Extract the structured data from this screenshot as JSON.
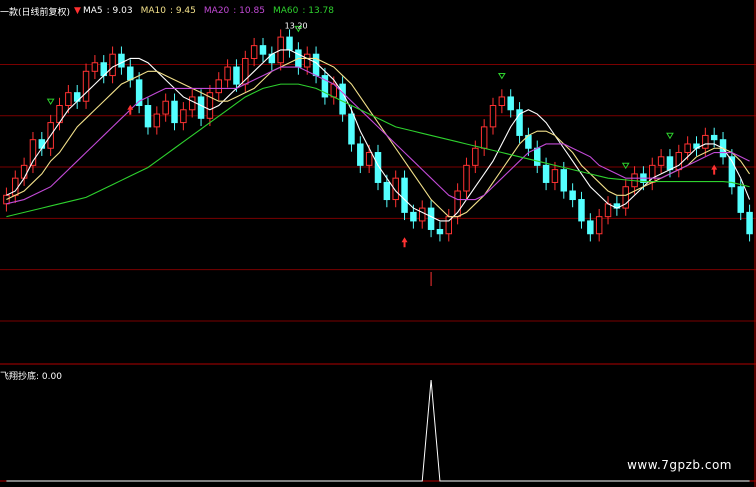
{
  "indicator": {
    "name": "一款(日线前复权)",
    "ma": [
      {
        "label": "MA5",
        "value": "9.03",
        "color": "#ffffff"
      },
      {
        "label": "MA10",
        "value": "9.45",
        "color": "#f2e08a"
      },
      {
        "label": "MA20",
        "value": "10.85",
        "color": "#c24ad6"
      },
      {
        "label": "MA60",
        "value": "13.78",
        "color": "#2ed12e"
      }
    ]
  },
  "sub_indicator": {
    "name": "飞翔抄底",
    "value": "0.00"
  },
  "watermark": "www.7gpzb.com",
  "colors": {
    "up": "#ff3232",
    "down": "#54ffff",
    "grid": "#7a0000",
    "spike": "#ffffff"
  },
  "chart_data": [
    {
      "type": "candlestick",
      "annotation": "13.20",
      "series": [
        {
          "name": "MA5",
          "values": [
            9.9,
            10.0,
            10.3,
            10.7,
            11.0,
            11.3,
            11.6,
            11.9,
            12.1,
            12.3,
            12.5,
            12.7,
            12.9,
            13.0,
            13.1,
            13.1,
            13.0,
            12.8,
            12.6,
            12.4,
            12.2,
            12.1,
            12.0,
            11.9,
            12.0,
            12.2,
            12.4,
            12.6,
            12.8,
            13.0,
            13.2,
            13.3,
            13.3,
            13.2,
            13.1,
            13.0,
            12.8,
            12.6,
            12.3,
            11.9,
            11.4,
            11.0,
            10.6,
            10.3,
            10.0,
            9.8,
            9.6,
            9.5,
            9.4,
            9.3,
            9.3,
            9.5,
            9.8,
            10.1,
            10.4,
            10.7,
            11.1,
            11.5,
            11.8,
            11.9,
            11.8,
            11.6,
            11.3,
            11.0,
            10.7,
            10.4,
            10.1,
            9.9,
            9.7,
            9.6,
            9.7,
            9.9,
            10.1,
            10.3,
            10.4,
            10.5,
            10.6,
            10.8,
            11.0,
            11.1,
            11.1,
            11.0,
            10.7,
            10.3,
            9.8
          ]
        },
        {
          "name": "MA10",
          "values": [
            9.8,
            9.9,
            10.0,
            10.2,
            10.4,
            10.7,
            10.9,
            11.2,
            11.5,
            11.7,
            11.9,
            12.1,
            12.3,
            12.5,
            12.6,
            12.7,
            12.8,
            12.8,
            12.7,
            12.6,
            12.5,
            12.4,
            12.3,
            12.2,
            12.1,
            12.1,
            12.2,
            12.3,
            12.4,
            12.6,
            12.8,
            12.9,
            13.0,
            13.1,
            13.1,
            13.1,
            13.0,
            12.9,
            12.7,
            12.5,
            12.2,
            11.9,
            11.6,
            11.3,
            11.0,
            10.7,
            10.4,
            10.1,
            9.8,
            9.6,
            9.4,
            9.4,
            9.5,
            9.7,
            9.9,
            10.2,
            10.5,
            10.8,
            11.1,
            11.3,
            11.4,
            11.4,
            11.3,
            11.1,
            10.9,
            10.6,
            10.4,
            10.2,
            10.0,
            9.9,
            9.9,
            10.0,
            10.1,
            10.2,
            10.3,
            10.4,
            10.5,
            10.6,
            10.8,
            10.9,
            11.0,
            11.0,
            10.9,
            10.7,
            10.4
          ]
        },
        {
          "name": "MA20",
          "values": [
            9.7,
            9.75,
            9.8,
            9.9,
            10.0,
            10.1,
            10.3,
            10.5,
            10.7,
            10.9,
            11.1,
            11.3,
            11.5,
            11.7,
            11.9,
            12.1,
            12.2,
            12.3,
            12.4,
            12.4,
            12.4,
            12.4,
            12.4,
            12.4,
            12.4,
            12.4,
            12.4,
            12.5,
            12.6,
            12.7,
            12.8,
            12.9,
            12.9,
            12.9,
            12.8,
            12.7,
            12.6,
            12.5,
            12.3,
            12.1,
            11.9,
            11.7,
            11.5,
            11.3,
            11.1,
            10.9,
            10.7,
            10.5,
            10.3,
            10.1,
            9.9,
            9.8,
            9.8,
            9.8,
            9.9,
            10.1,
            10.3,
            10.5,
            10.7,
            10.9,
            11.0,
            11.1,
            11.1,
            11.1,
            11.0,
            10.9,
            10.8,
            10.6,
            10.5,
            10.4,
            10.3,
            10.3,
            10.3,
            10.3,
            10.3,
            10.4,
            10.5,
            10.6,
            10.7,
            10.8,
            10.9,
            10.9,
            10.9,
            10.8,
            10.7
          ]
        },
        {
          "name": "MA60",
          "values": [
            9.4,
            9.45,
            9.5,
            9.55,
            9.6,
            9.65,
            9.7,
            9.75,
            9.8,
            9.85,
            9.95,
            10.05,
            10.15,
            10.25,
            10.35,
            10.45,
            10.55,
            10.7,
            10.85,
            11.0,
            11.15,
            11.3,
            11.45,
            11.6,
            11.75,
            11.9,
            12.05,
            12.2,
            12.3,
            12.4,
            12.45,
            12.5,
            12.5,
            12.5,
            12.45,
            12.4,
            12.3,
            12.2,
            12.1,
            12.0,
            11.9,
            11.8,
            11.7,
            11.6,
            11.5,
            11.45,
            11.4,
            11.35,
            11.3,
            11.25,
            11.2,
            11.15,
            11.1,
            11.05,
            11.0,
            10.95,
            10.9,
            10.85,
            10.8,
            10.75,
            10.7,
            10.65,
            10.6,
            10.55,
            10.5,
            10.45,
            10.4,
            10.35,
            10.3,
            10.28,
            10.26,
            10.24,
            10.22,
            10.22,
            10.22,
            10.22,
            10.22,
            10.22,
            10.22,
            10.22,
            10.22,
            10.22,
            10.2,
            10.15,
            10.1
          ]
        }
      ],
      "candles_close": [
        9.9,
        10.3,
        10.6,
        11.2,
        11.0,
        11.6,
        12.0,
        12.3,
        12.1,
        12.8,
        13.0,
        12.7,
        13.2,
        12.9,
        12.6,
        12.0,
        11.5,
        11.8,
        12.1,
        11.6,
        11.9,
        12.2,
        11.7,
        12.3,
        12.6,
        12.9,
        12.5,
        13.1,
        13.4,
        13.2,
        13.0,
        13.6,
        13.3,
        12.9,
        13.2,
        12.7,
        12.2,
        12.5,
        11.8,
        11.1,
        10.6,
        10.9,
        10.2,
        9.8,
        10.3,
        9.5,
        9.3,
        9.6,
        9.1,
        9.0,
        9.4,
        10.0,
        10.6,
        11.0,
        11.5,
        12.0,
        12.2,
        11.9,
        11.3,
        11.0,
        10.6,
        10.2,
        10.5,
        10.0,
        9.8,
        9.3,
        9.0,
        9.4,
        9.7,
        9.6,
        10.1,
        10.4,
        10.2,
        10.6,
        10.8,
        10.5,
        10.9,
        11.1,
        11.0,
        11.3,
        11.2,
        10.8,
        10.1,
        9.5,
        9.0
      ],
      "candles_open": [
        9.7,
        9.9,
        10.3,
        10.6,
        11.2,
        11.0,
        11.6,
        12.0,
        12.3,
        12.1,
        12.8,
        13.0,
        12.7,
        13.2,
        12.9,
        12.6,
        12.0,
        11.5,
        11.8,
        12.1,
        11.6,
        11.9,
        12.2,
        11.7,
        12.3,
        12.6,
        12.9,
        12.5,
        13.1,
        13.4,
        13.2,
        13.0,
        13.6,
        13.3,
        12.9,
        13.2,
        12.7,
        12.2,
        12.5,
        11.8,
        11.1,
        10.6,
        10.9,
        10.2,
        9.8,
        10.3,
        9.5,
        9.3,
        9.6,
        9.1,
        9.0,
        9.4,
        10.0,
        10.6,
        11.0,
        11.5,
        12.0,
        12.2,
        11.9,
        11.3,
        11.0,
        10.6,
        10.2,
        10.5,
        10.0,
        9.8,
        9.3,
        9.0,
        9.4,
        9.7,
        9.6,
        10.1,
        10.4,
        10.2,
        10.6,
        10.8,
        10.5,
        10.9,
        11.1,
        11.0,
        11.3,
        11.2,
        10.8,
        10.1,
        9.5
      ],
      "buy_arrows": [
        14,
        45,
        80
      ],
      "sell_marks": [
        5,
        33,
        56,
        70,
        75
      ]
    },
    {
      "type": "line",
      "name": "飞翔抄底",
      "values": [
        0,
        0,
        0,
        0,
        0,
        0,
        0,
        0,
        0,
        0,
        0,
        0,
        0,
        0,
        0,
        0,
        0,
        0,
        0,
        0,
        0,
        0,
        0,
        0,
        0,
        0,
        0,
        0,
        0,
        0,
        0,
        0,
        0,
        0,
        0,
        0,
        0,
        0,
        0,
        0,
        0,
        0,
        0,
        0,
        0,
        0,
        0,
        0,
        1,
        0,
        0,
        0,
        0,
        0,
        0,
        0,
        0,
        0,
        0,
        0,
        0,
        0,
        0,
        0,
        0,
        0,
        0,
        0,
        0,
        0,
        0,
        0,
        0,
        0,
        0,
        0,
        0,
        0,
        0,
        0,
        0,
        0,
        0,
        0,
        0
      ],
      "ylim": [
        0,
        1
      ]
    }
  ]
}
